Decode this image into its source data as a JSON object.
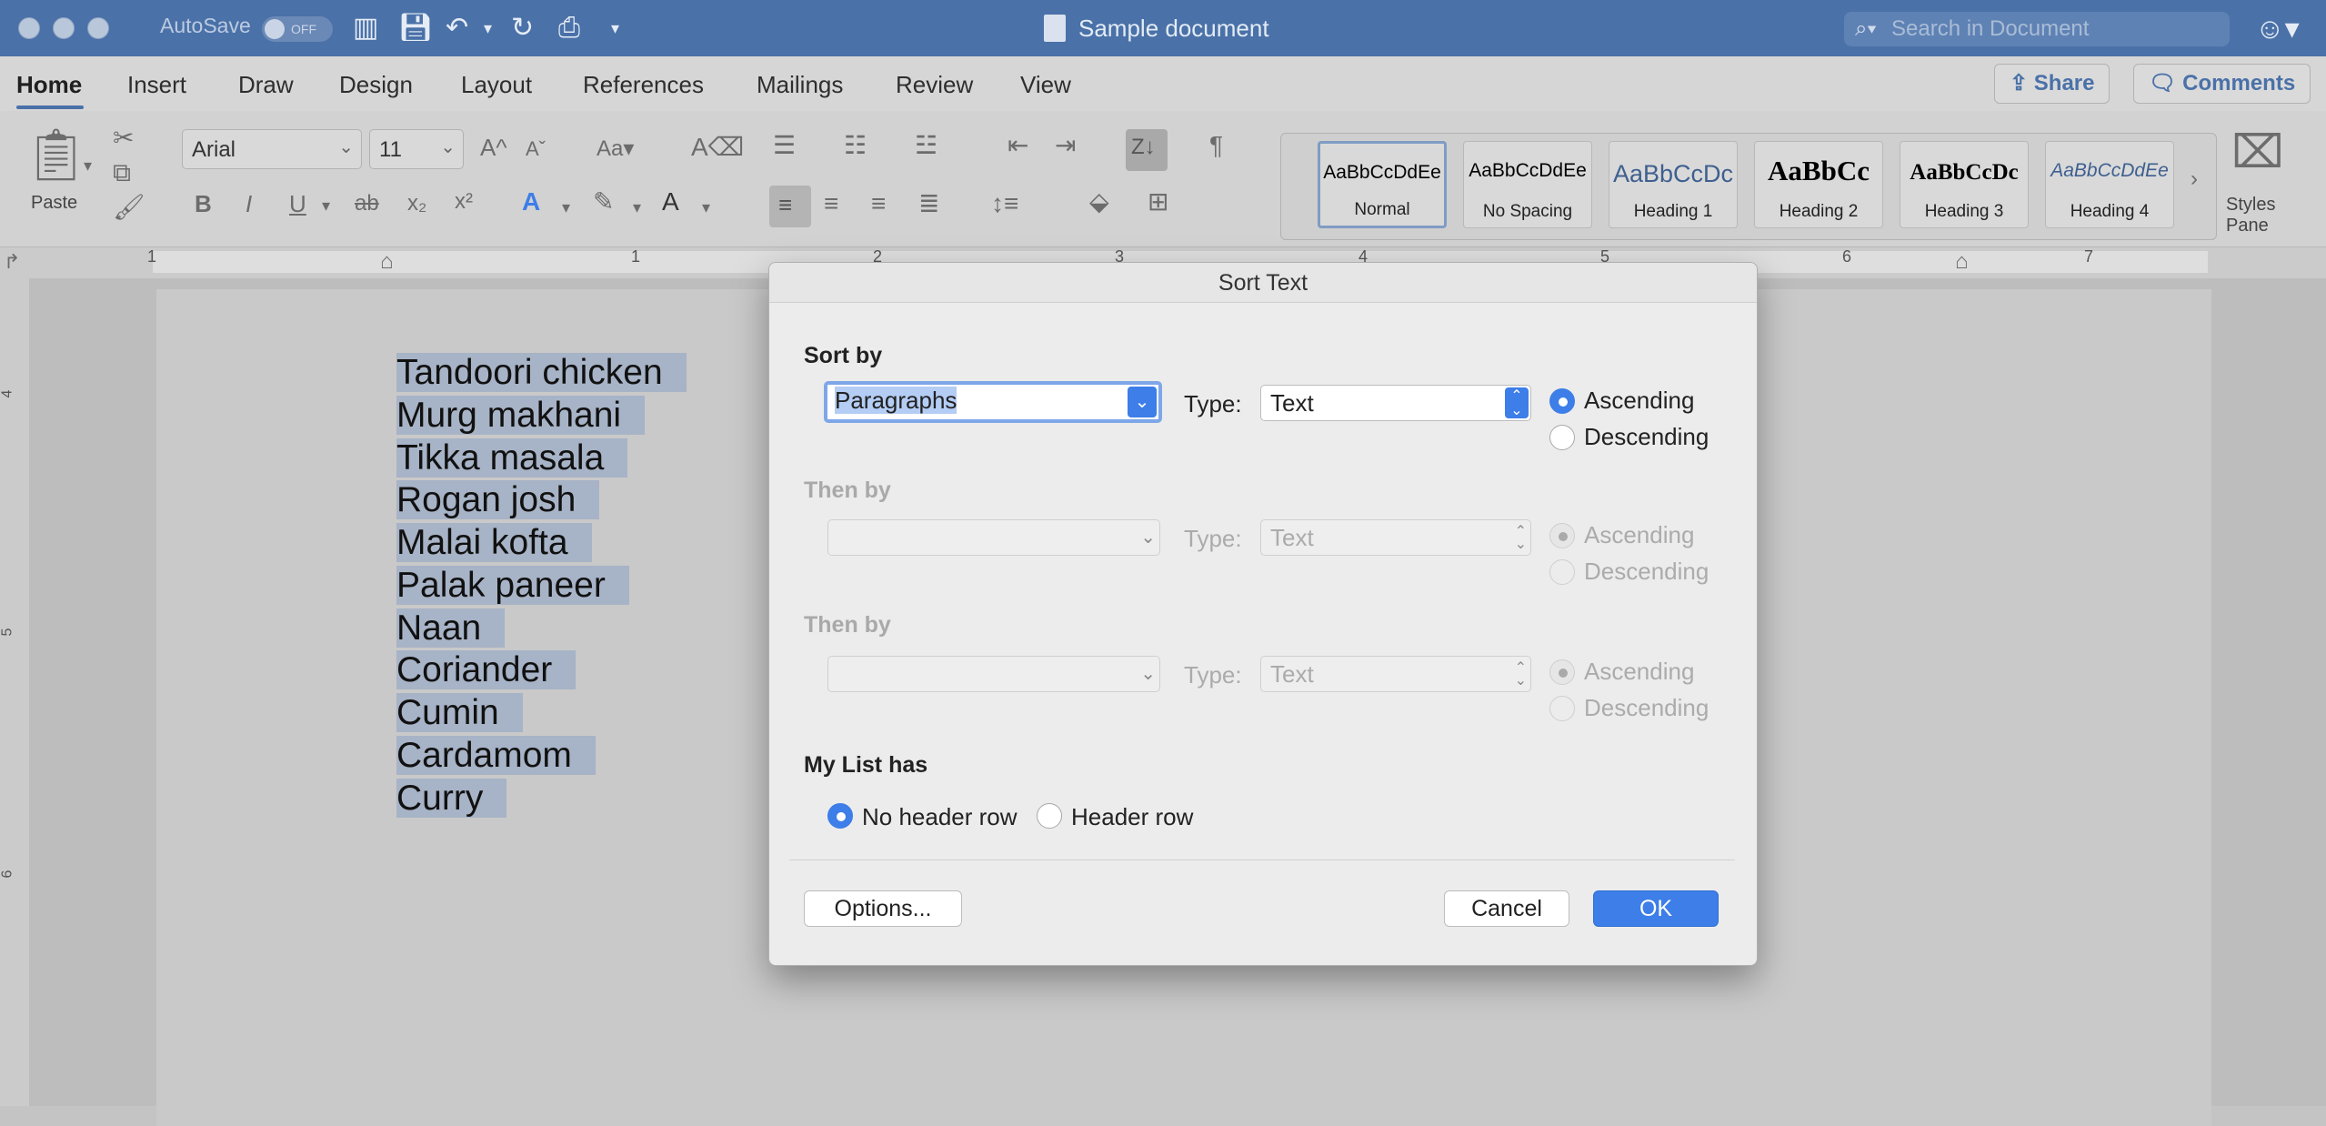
{
  "titlebar": {
    "autosave_label": "AutoSave",
    "autosave_state": "OFF",
    "doc_title": "Sample document",
    "search_placeholder": "Search in Document"
  },
  "tabs": [
    "Home",
    "Insert",
    "Draw",
    "Design",
    "Layout",
    "References",
    "Mailings",
    "Review",
    "View"
  ],
  "active_tab": "Home",
  "share_label": "Share",
  "comments_label": "Comments",
  "ribbon": {
    "paste_label": "Paste",
    "font_name": "Arial",
    "font_size": "11",
    "styles": [
      {
        "sample": "AaBbCcDdEe",
        "name": "Normal"
      },
      {
        "sample": "AaBbCcDdEe",
        "name": "No Spacing"
      },
      {
        "sample": "AaBbCcDc",
        "name": "Heading 1"
      },
      {
        "sample": "AaBbCc",
        "name": "Heading 2"
      },
      {
        "sample": "AaBbCcDc",
        "name": "Heading 3"
      },
      {
        "sample": "AaBbCcDdEe",
        "name": "Heading 4"
      }
    ],
    "styles_pane_label_1": "Styles",
    "styles_pane_label_2": "Pane"
  },
  "ruler": {
    "marks": [
      "1",
      "1",
      "2",
      "3",
      "4",
      "5",
      "6",
      "7"
    ],
    "vmarks": [
      "4",
      "5",
      "6"
    ]
  },
  "document": {
    "lines": [
      "Tandoori chicken",
      "Murg makhani",
      "Tikka masala",
      "Rogan josh",
      "Malai kofta",
      "Palak paneer",
      "Naan",
      "Coriander",
      "Cumin",
      "Cardamom",
      "Curry"
    ]
  },
  "dialog": {
    "title": "Sort Text",
    "sort_by_label": "Sort by",
    "sort_by_value": "Paragraphs",
    "type_label": "Type:",
    "type_value": "Text",
    "ascending": "Ascending",
    "descending": "Descending",
    "then_by_1_label": "Then by",
    "then_by_2_label": "Then by",
    "disabled_type_value": "Text",
    "my_list_has": "My List has",
    "no_header_row": "No header row",
    "header_row": "Header row",
    "options_button": "Options...",
    "cancel_button": "Cancel",
    "ok_button": "OK"
  }
}
